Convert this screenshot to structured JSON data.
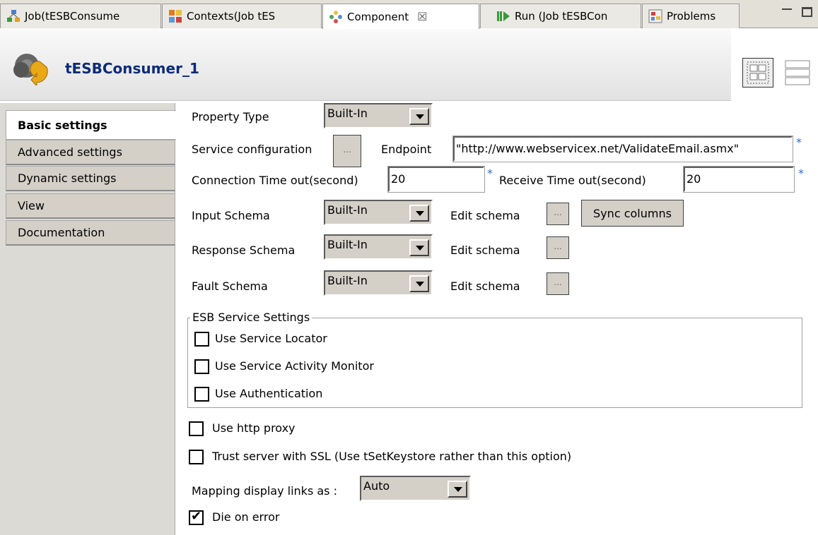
{
  "tabs": [
    {
      "label": "Job(tESBConsume",
      "icon": "job-icon"
    },
    {
      "label": "Contexts(Job tES",
      "icon": "contexts-icon"
    },
    {
      "label": "Component",
      "icon": "component-icon",
      "close": "☒"
    },
    {
      "label": "Run (Job tESBCon",
      "icon": "run-icon"
    },
    {
      "label": "Problems",
      "icon": "problems-icon"
    }
  ],
  "header": {
    "title": "tESBConsumer_1",
    "icon": "component-gear-icon"
  },
  "nav": [
    {
      "label": "Basic settings"
    },
    {
      "label": "Advanced settings"
    },
    {
      "label": "Dynamic settings"
    },
    {
      "label": "View"
    },
    {
      "label": "Documentation"
    }
  ],
  "form": {
    "property_type_label": "Property Type",
    "property_type_value": "Built-In",
    "service_config_label": "Service configuration",
    "ellipsis": "...",
    "endpoint_label": "Endpoint",
    "endpoint_value": "\"http://www.webservicex.net/ValidateEmail.asmx\"",
    "required_marker": "*",
    "conn_timeout_label": "Connection Time out(second)",
    "conn_timeout_value": "20",
    "recv_timeout_label": "Receive Time out(second)",
    "recv_timeout_value": "20",
    "input_schema_label": "Input Schema",
    "input_schema_value": "Built-In",
    "edit_schema_label": "Edit schema",
    "sync_columns_label": "Sync columns",
    "response_schema_label": "Response Schema",
    "response_schema_value": "Built-In",
    "fault_schema_label": "Fault Schema",
    "fault_schema_value": "Built-In",
    "esb_group_title": "ESB Service Settings",
    "use_service_locator": "Use Service Locator",
    "use_service_activity_monitor": "Use Service Activity Monitor",
    "use_authentication": "Use Authentication",
    "use_http_proxy": "Use http proxy",
    "trust_ssl": "Trust server with SSL (Use tSetKeystore rather than this option)",
    "mapping_label": "Mapping display links as :",
    "mapping_value": "Auto",
    "die_on_error": "Die on error"
  },
  "checkbox_states": {
    "use_service_locator": false,
    "use_service_activity_monitor": false,
    "use_authentication": false,
    "use_http_proxy": false,
    "trust_ssl": false,
    "die_on_error": true
  },
  "colors": {
    "title_blue": "#0b2c7a",
    "required_blue": "#2a6fd0",
    "panel_gray": "#d4d0c8"
  }
}
